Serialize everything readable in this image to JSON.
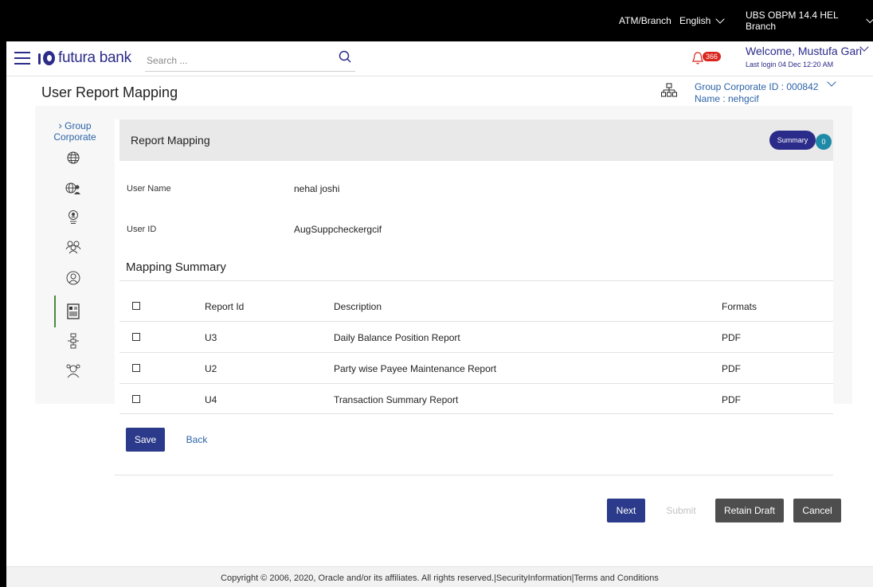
{
  "topbar": {
    "atm_branch": "ATM/Branch",
    "language": "English",
    "entity": "UBS OBPM 14.4 HEL Branch"
  },
  "header": {
    "brand": "futura bank",
    "search_placeholder": "Search ...",
    "notification_count": "366",
    "welcome": "Welcome, Mustufa Gari",
    "last_login": "Last login 04 Dec 12:20 AM"
  },
  "page": {
    "title": "User Report Mapping",
    "group_corporate_id": "Group Corporate ID : 000842",
    "group_corporate_name": "Name : nehgcif"
  },
  "sidebar": {
    "label": "Group Corporate",
    "icons": [
      "globe-icon",
      "globe-user-icon",
      "user-badge-icon",
      "users-group-icon",
      "user-support-icon",
      "report-icon",
      "workflow-icon",
      "user-settings-icon"
    ]
  },
  "panel": {
    "title": "Report Mapping",
    "summary_label": "Summary",
    "summary_count": "0",
    "user_name_label": "User Name",
    "user_name_value": "nehal joshi",
    "user_id_label": "User ID",
    "user_id_value": "AugSuppcheckergcif",
    "section_title": "Mapping Summary"
  },
  "table": {
    "headers": [
      "Report Id",
      "Description",
      "Formats"
    ],
    "rows": [
      {
        "id": "U3",
        "description": "Daily Balance Position Report",
        "format": "PDF"
      },
      {
        "id": "U2",
        "description": "Party wise Payee Maintenance Report",
        "format": "PDF"
      },
      {
        "id": "U4",
        "description": "Transaction Summary Report",
        "format": "PDF"
      }
    ]
  },
  "actions": {
    "save": "Save",
    "back": "Back",
    "next": "Next",
    "submit": "Submit",
    "retain_draft": "Retain Draft",
    "cancel": "Cancel"
  },
  "footer": {
    "text": "Copyright © 2006, 2020, Oracle and/or its affiliates. All rights reserved.|SecurityInformation|Terms and Conditions"
  },
  "colors": {
    "primary": "#2b2b8a",
    "link": "#2b63a8",
    "badge": "#d9261c",
    "dark_button": "#4e4e4e"
  }
}
